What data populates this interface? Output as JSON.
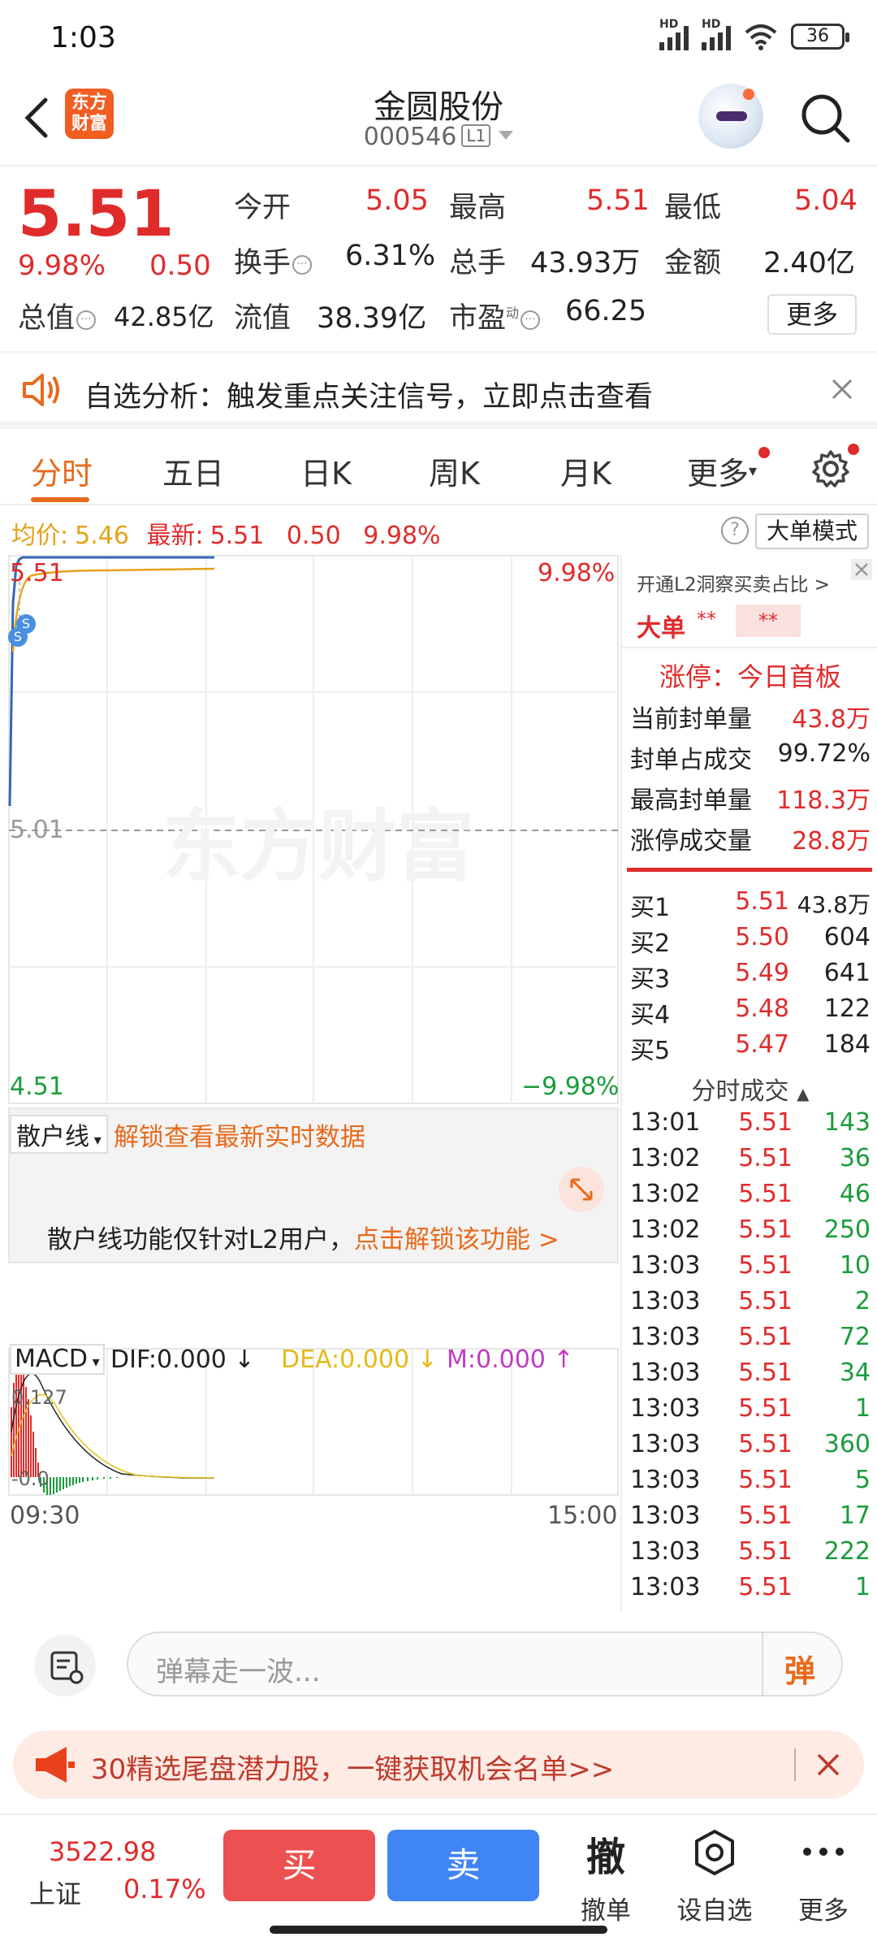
{
  "status": {
    "time": "1:03",
    "signal1": "HD",
    "signal2": "HD",
    "battery": "36"
  },
  "header": {
    "logo_line1": "东方",
    "logo_line2": "财富",
    "stock_name": "金圆股份",
    "stock_code": "000546",
    "level": "L1"
  },
  "quote": {
    "price": "5.51",
    "change_pct": "9.98%",
    "change_abs": "0.50",
    "open_label": "今开",
    "open": "5.05",
    "high_label": "最高",
    "high": "5.51",
    "low_label": "最低",
    "low": "5.04",
    "turnover_label": "换手",
    "turnover": "6.31%",
    "volume_label": "总手",
    "volume": "43.93万",
    "amount_label": "金额",
    "amount": "2.40亿",
    "mktcap_label": "总值",
    "mktcap": "42.85亿",
    "float_label": "流值",
    "float": "38.39亿",
    "pe_label": "市盈",
    "pe_sup": "动",
    "pe": "66.25",
    "more_label": "更多"
  },
  "notice": {
    "text": "自选分析：触发重点关注信号，立即点击查看"
  },
  "tabs": [
    "分时",
    "五日",
    "日K",
    "周K",
    "月K",
    "更多"
  ],
  "info": {
    "avg_label": "均价:",
    "avg": "5.46",
    "latest_label": "最新:",
    "latest": "5.51",
    "chg": "0.50",
    "pct": "9.98%",
    "mode_label": "大单模式"
  },
  "chart": {
    "y_top": "5.51",
    "y_mid": "5.01",
    "y_bottom": "4.51",
    "pct_top": "9.98%",
    "pct_bottom": "−9.98%",
    "watermark": "东方财富",
    "badge": "S"
  },
  "retail": {
    "dropdown": "散户线",
    "unlock_title": "解锁查看最新实时数据",
    "msg": "散户线功能仅针对L2用户，",
    "link": "点击解锁该功能 >"
  },
  "macd": {
    "dropdown": "MACD",
    "dif": "DIF:0.000",
    "dea": "DEA:0.000",
    "m": "M:0.000",
    "y_top": "0.127",
    "y_bottom": "-0.0",
    "time_start": "09:30",
    "time_end": "15:00"
  },
  "right_panel": {
    "l2_link": "开通L2洞察买卖占比 >",
    "big_order": "大单",
    "stars1": "**",
    "stars2": "**",
    "limit_title": "涨停：今日首板",
    "stats": [
      {
        "label": "当前封单量",
        "value": "43.8万"
      },
      {
        "label": "封单占成交",
        "value": "99.72%"
      },
      {
        "label": "最高封单量",
        "value": "118.3万"
      },
      {
        "label": "涨停成交量",
        "value": "28.8万"
      }
    ],
    "bids": [
      {
        "label": "买1",
        "price": "5.51",
        "vol": "43.8万"
      },
      {
        "label": "买2",
        "price": "5.50",
        "vol": "604"
      },
      {
        "label": "买3",
        "price": "5.49",
        "vol": "641"
      },
      {
        "label": "买4",
        "price": "5.48",
        "vol": "122"
      },
      {
        "label": "买5",
        "price": "5.47",
        "vol": "184"
      }
    ],
    "ticks_title": "分时成交",
    "ticks": [
      {
        "time": "13:01",
        "price": "5.51",
        "vol": "143"
      },
      {
        "time": "13:02",
        "price": "5.51",
        "vol": "36"
      },
      {
        "time": "13:02",
        "price": "5.51",
        "vol": "46"
      },
      {
        "time": "13:02",
        "price": "5.51",
        "vol": "250"
      },
      {
        "time": "13:03",
        "price": "5.51",
        "vol": "10"
      },
      {
        "time": "13:03",
        "price": "5.51",
        "vol": "2"
      },
      {
        "time": "13:03",
        "price": "5.51",
        "vol": "72"
      },
      {
        "time": "13:03",
        "price": "5.51",
        "vol": "34"
      },
      {
        "time": "13:03",
        "price": "5.51",
        "vol": "1"
      },
      {
        "time": "13:03",
        "price": "5.51",
        "vol": "360"
      },
      {
        "time": "13:03",
        "price": "5.51",
        "vol": "5"
      },
      {
        "time": "13:03",
        "price": "5.51",
        "vol": "17"
      },
      {
        "time": "13:03",
        "price": "5.51",
        "vol": "222"
      },
      {
        "time": "13:03",
        "price": "5.51",
        "vol": "1"
      }
    ]
  },
  "comment": {
    "placeholder": "弹幕走一波...",
    "danmu": "弹"
  },
  "promo": {
    "text": "30精选尾盘潜力股，一键获取机会名单>>"
  },
  "bottom": {
    "index_value": "3522.98",
    "index_name": "上证",
    "index_pct": "0.17%",
    "buy": "买",
    "sell": "卖",
    "cancel_icon": "撤",
    "cancel": "撤单",
    "watch": "设自选",
    "more": "更多"
  }
}
